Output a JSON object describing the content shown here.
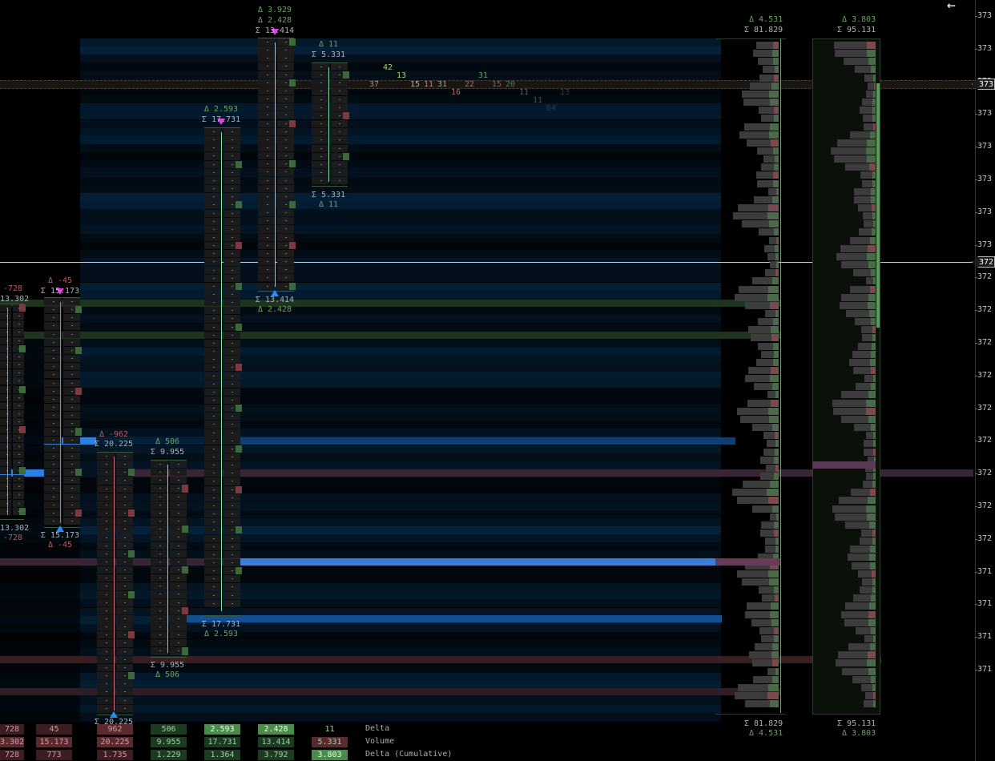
{
  "price_axis": {
    "ticks": [
      "373",
      "373",
      "373",
      "373",
      "373",
      "373",
      "373",
      "373",
      "372",
      "372",
      "372",
      "372",
      "372",
      "372",
      "372",
      "372",
      "372",
      "371",
      "371",
      "371",
      "371"
    ],
    "current_price_tag": "373",
    "crosshair_price_tag": "372"
  },
  "navigation": {
    "back_icon": "←"
  },
  "clusters": [
    {
      "id": "c1",
      "sum_top": "13.302",
      "delta_top": "-728",
      "sum_bottom": "13.302",
      "delta_bottom": "-728",
      "positive": false
    },
    {
      "id": "c2",
      "sum_top": "Σ 15.173",
      "delta_top": "Δ -45",
      "sum_bottom": "Σ 15.173",
      "delta_bottom": "Δ -45",
      "positive": false
    },
    {
      "id": "c3",
      "sum_top": "Σ 20.225",
      "delta_top": "Δ -962",
      "sum_bottom": "Σ 20.225",
      "positive": false
    },
    {
      "id": "c4",
      "sum_top": "Σ 9.955",
      "delta_top": "Δ 506",
      "sum_bottom": "Σ 9.955",
      "delta_bottom": "Δ 506",
      "positive": true
    },
    {
      "id": "c5",
      "sum_top": "Σ 17.731",
      "delta_top": "Δ 2.593",
      "sum_bottom": "Σ 17.731",
      "delta_bottom": "Δ 2.593",
      "positive": true
    },
    {
      "id": "c6",
      "sum_top": "Σ 13.414",
      "delta_top": "Δ 2.428",
      "delta_top2": "Δ 3.929",
      "sum_bottom": "Σ 13.414",
      "delta_bottom": "Δ 2.428",
      "positive": true
    },
    {
      "id": "c7",
      "sum_top": "Σ 5.331",
      "delta_top": "Δ 11",
      "sum_bottom": "Σ 5.331",
      "delta_bottom": "Δ 11",
      "positive": true
    }
  ],
  "profiles": [
    {
      "id": "p1",
      "delta_top": "Δ 4.531",
      "sum_top": "Σ 81.829",
      "sum_bottom": "Σ 81.829",
      "delta_bottom": "Δ 4.531"
    },
    {
      "id": "p2",
      "delta_top": "Δ 3.803",
      "sum_top": "Σ 95.131",
      "sum_bottom": "Σ 95.131",
      "delta_bottom": "Δ 3.803"
    }
  ],
  "prints": [
    {
      "text": "42",
      "color": "#a4d07a"
    },
    {
      "text": "37",
      "color": "#d07a7a"
    },
    {
      "text": "13",
      "color": "#a4d07a"
    },
    {
      "text": "15",
      "color": "#8fc07a"
    },
    {
      "text": "11",
      "color": "#c07a7a"
    },
    {
      "text": "31",
      "color": "#8fb07a"
    },
    {
      "text": "16",
      "color": "#b06a6a"
    },
    {
      "text": "22",
      "color": "#a06a6a"
    },
    {
      "text": "31",
      "color": "#6a9a6a"
    },
    {
      "text": "15",
      "color": "#8a5a5a"
    },
    {
      "text": "20",
      "color": "#4a7a5a"
    },
    {
      "text": "11",
      "color": "#3a6a5a"
    },
    {
      "text": "11",
      "color": "#2f5a50"
    },
    {
      "text": "13",
      "color": "#3a3a3a"
    },
    {
      "text": "64",
      "color": "#2f3a40"
    }
  ],
  "stats": {
    "row_labels": [
      "Delta",
      "Volume",
      "Delta (Cumulative)"
    ],
    "columns": [
      {
        "delta": "728",
        "volume": "3.302",
        "cum": "728"
      },
      {
        "delta": "45",
        "volume": "15.173",
        "cum": "773"
      },
      {
        "delta": "962",
        "volume": "20.225",
        "cum": "1.735"
      },
      {
        "delta": "506",
        "volume": "9.955",
        "cum": "1.229"
      },
      {
        "delta": "2.593",
        "volume": "17.731",
        "cum": "1.364"
      },
      {
        "delta": "2.428",
        "volume": "13.414",
        "cum": "3.792"
      },
      {
        "delta": "11",
        "volume": "5.331",
        "cum": "3.803"
      }
    ]
  },
  "colors": {
    "buy": "#4a9a5a",
    "sell": "#a04a55",
    "highlight_blue": "#2f7fe0",
    "arrow_up": "#1e90ff",
    "arrow_down": "#e040e0",
    "poc_green": "#1e3a22",
    "poc_purple": "#3a1e3a"
  }
}
